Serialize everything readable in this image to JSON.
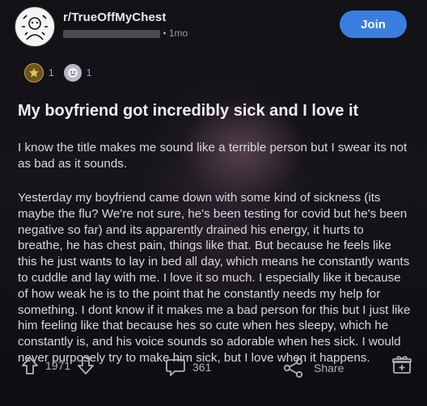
{
  "header": {
    "subreddit": "r/TrueOffMyChest",
    "time": "• 1mo",
    "join_label": "Join"
  },
  "awards": [
    {
      "icon": "gold-award-icon",
      "count": "1"
    },
    {
      "icon": "wholesome-award-icon",
      "count": "1"
    }
  ],
  "post": {
    "title": "My boyfriend got incredibly sick and I love it",
    "paragraphs": [
      "I know the title makes me sound like a terrible person but I swear its not as bad as it sounds.",
      "Yesterday my boyfriend came down with some kind of sickness (its maybe the flu? We're not sure, he's been testing for covid but he's been negative so far) and its apparently drained his energy, it hurts to breathe, he has chest pain, things like that. But because he feels like this he just wants to lay in bed all day, which means he constantly wants to cuddle and lay with me. I love it so much. I especially like it because of how weak he is to the point that he constantly needs my help for something. I dont know if it makes me a bad person for this but I just like him feeling like that because hes so cute when hes sleepy, which he constantly is, and his voice sounds so adorable when hes sick. I would never purposely try to make him sick, but I love when it happens."
    ]
  },
  "footer": {
    "upvotes": "1971",
    "comments": "361",
    "share_label": "Share"
  },
  "colors": {
    "join": "#3a7ee0",
    "background": "#0d0c10"
  }
}
